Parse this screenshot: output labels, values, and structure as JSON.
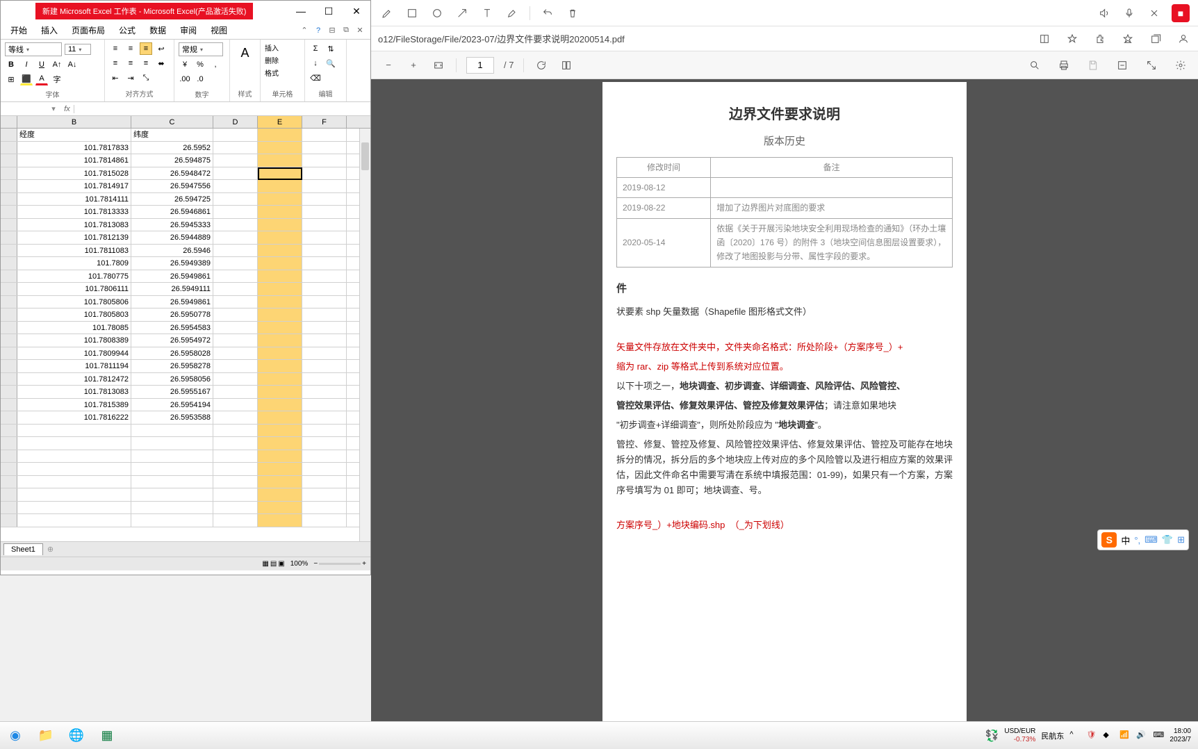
{
  "excel": {
    "title": "新建 Microsoft Excel 工作表 - Microsoft Excel(产品激活失败)",
    "menus": [
      "开始",
      "插入",
      "页面布局",
      "公式",
      "数据",
      "审阅",
      "视图"
    ],
    "font_name": "等线",
    "font_size": "11",
    "number_format": "常规",
    "ribbon_groups": {
      "font": "字体",
      "align": "对齐方式",
      "number": "数字",
      "style": "样式",
      "cells": "单元格",
      "edit": "编辑"
    },
    "cells_actions": {
      "insert": "插入",
      "delete": "删除",
      "format": "格式"
    },
    "cols": [
      "B",
      "C",
      "D",
      "E",
      "F"
    ],
    "headers": {
      "B": "经度",
      "C": "纬度"
    },
    "rows": [
      [
        "101.7817833",
        "26.5952"
      ],
      [
        "101.7814861",
        "26.594875"
      ],
      [
        "101.7815028",
        "26.5948472"
      ],
      [
        "101.7814917",
        "26.5947556"
      ],
      [
        "101.7814111",
        "26.594725"
      ],
      [
        "101.7813333",
        "26.5946861"
      ],
      [
        "101.7813083",
        "26.5945333"
      ],
      [
        "101.7812139",
        "26.5944889"
      ],
      [
        "101.7811083",
        "26.5946"
      ],
      [
        "101.7809",
        "26.5949389"
      ],
      [
        "101.780775",
        "26.5949861"
      ],
      [
        "101.7806111",
        "26.5949111"
      ],
      [
        "101.7805806",
        "26.5949861"
      ],
      [
        "101.7805803",
        "26.5950778"
      ],
      [
        "101.78085",
        "26.5954583"
      ],
      [
        "101.7808389",
        "26.5954972"
      ],
      [
        "101.7809944",
        "26.5958028"
      ],
      [
        "101.7811194",
        "26.5958278"
      ],
      [
        "101.7812472",
        "26.5958056"
      ],
      [
        "101.7813083",
        "26.5955167"
      ],
      [
        "101.7815389",
        "26.5954194"
      ],
      [
        "101.7816222",
        "26.5953588"
      ]
    ],
    "sheet_tab": "Sheet1",
    "zoom": "100%"
  },
  "edge": {
    "path": "o12/FileStorage/File/2023-07/边界文件要求说明20200514.pdf"
  },
  "pdf": {
    "page_current": "1",
    "page_total": "/ 7",
    "title": "边界文件要求说明",
    "subtitle": "版本历史",
    "table_headers": {
      "date": "修改时间",
      "note": "备注"
    },
    "history": [
      {
        "date": "2019-08-12",
        "note": ""
      },
      {
        "date": "2019-08-22",
        "note": "增加了边界图片对底图的要求"
      },
      {
        "date": "2020-05-14",
        "note": "依据《关于开展污染地块安全利用现场检查的通知》（环办土壤函〔2020〕176 号）的附件 3（地块空间信息图层设置要求），修改了地图投影与分带、属性字段的要求。"
      }
    ],
    "section1": "件",
    "para1": "状要素 shp 矢量数据（Shapefile 图形格式文件）",
    "para2a": "矢量文件存放在文件夹中，文件夹命名格式：所处阶段+（方案序号_）+",
    "para2b": "缩为 rar、zip 等格式上传到系统对应位置。",
    "para3a": "以下十项之一，",
    "para3b": "地块调查、初步调查、详细调查、风险评估、风险管控、",
    "para3c": "管控效果评估、修复效果评估、管控及修复效果评估",
    "para3d": "；请注意如果地块",
    "para3e": "\"初步调查+详细调查\"，则所处阶段应为 \"",
    "para3f": "地块调查",
    "para3g": "\"。",
    "para4": "管控、修复、管控及修复、风险管控效果评估、修复效果评估、管控及可能存在地块拆分的情况，拆分后的多个地块应上传对应的多个风险管以及进行相应方案的效果评估，因此文件命名中需要写清在系统中填报范围：01-99)，如果只有一个方案，方案序号填写为 01 即可；地块调查、号。",
    "para5a": "方案序号_）+地块编码.shp",
    "para5b": "（_为下划线）"
  },
  "ime": {
    "lang": "中"
  },
  "taskbar": {
    "currency_pair": "USD/EUR",
    "currency_change": "-0.73%",
    "weather": "民航东",
    "time": "18:00",
    "date": "2023/7"
  }
}
